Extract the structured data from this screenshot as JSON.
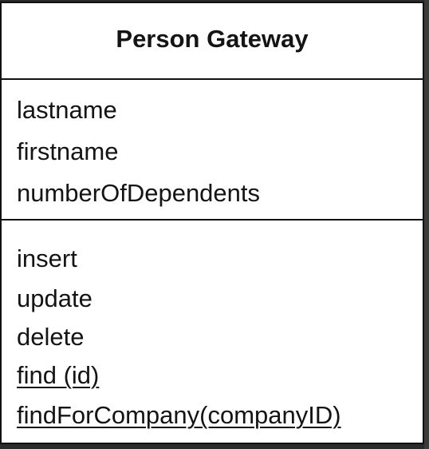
{
  "class_name": "Person Gateway",
  "attributes": [
    "lastname",
    "firstname",
    "numberOfDependents"
  ],
  "operations": [
    "insert",
    "update",
    "delete",
    "find (id)",
    "findForCompany(companyID)"
  ],
  "static_operations": [
    "find (id)",
    "findForCompany(companyID)"
  ]
}
